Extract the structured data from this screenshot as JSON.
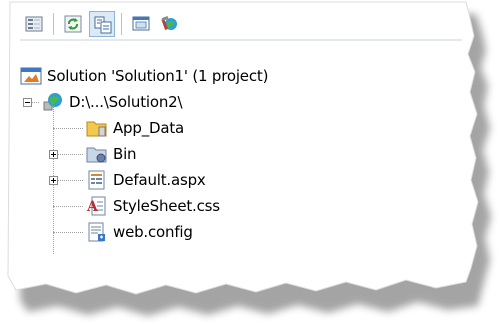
{
  "toolbar": {
    "buttons": [
      {
        "icon": "properties-icon",
        "active": false
      },
      {
        "icon": "refresh-icon",
        "active": false
      },
      {
        "icon": "nest-related-files-icon",
        "active": true
      },
      {
        "icon": "view-in-browser-icon",
        "active": false
      },
      {
        "icon": "asp-net-configuration-icon",
        "active": false
      }
    ]
  },
  "tree": {
    "solution_label": "Solution 'Solution1' (1 project)",
    "project_label": "D:\\...\\Solution2\\",
    "items": [
      {
        "label": "App_Data",
        "icon": "folder-icon"
      },
      {
        "label": "Bin",
        "icon": "bin-folder-icon"
      },
      {
        "label": "Default.aspx",
        "icon": "aspx-file-icon"
      },
      {
        "label": "StyleSheet.css",
        "icon": "css-file-icon"
      },
      {
        "label": "web.config",
        "icon": "config-file-icon"
      }
    ]
  },
  "colors": {
    "accent": "#2f6fb5",
    "folder": "#f2c94c",
    "toolbar_active_bg": "#dce9f7"
  }
}
